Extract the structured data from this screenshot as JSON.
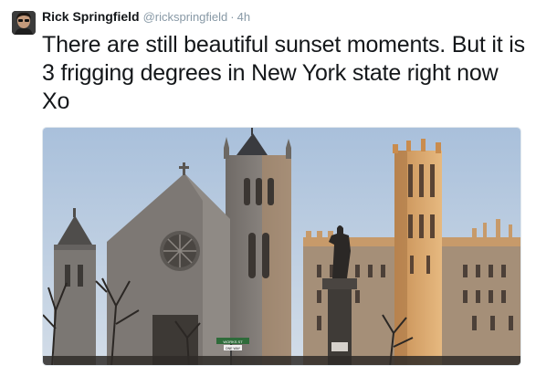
{
  "tweet": {
    "display_name": "Rick Springfield",
    "handle": "@rickspringfield",
    "separator": "·",
    "timestamp": "4h",
    "text": "There are still beautiful sunset moments.  But it is 3 frigging degrees in New York state right now Xo"
  },
  "media": {
    "street_sign_top": "WORKS ST",
    "street_sign_bottom": "ONE WAY",
    "colors": {
      "sky": "#b9cbe0",
      "stone": "#8d8a86",
      "sunlit_stone": "#d8a56c",
      "shadow": "#3a3531"
    }
  }
}
